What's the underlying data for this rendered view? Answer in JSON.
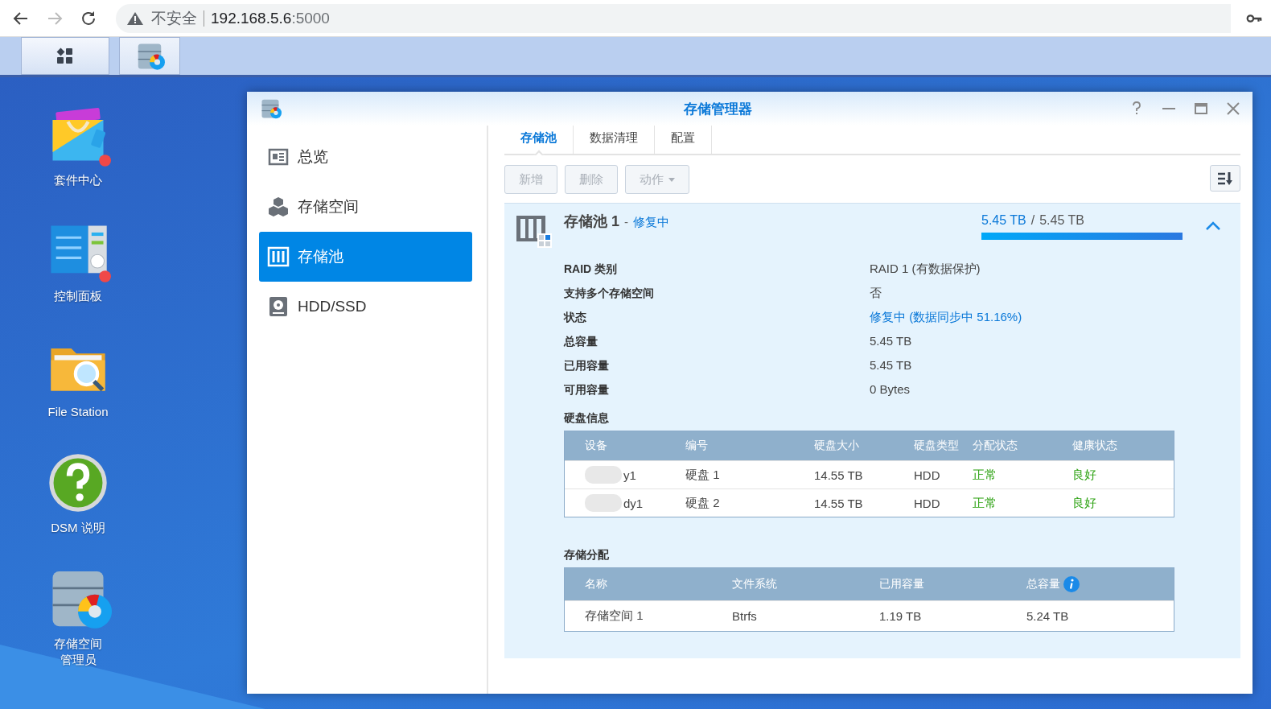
{
  "browser": {
    "security": "不安全",
    "url_host": "192.168.5.6",
    "url_port": ":5000"
  },
  "desktop_icons": [
    {
      "label": "套件中心",
      "kind": "package",
      "badge": true
    },
    {
      "label": "控制面板",
      "kind": "control",
      "badge": true
    },
    {
      "label": "File Station",
      "kind": "folder",
      "badge": false
    },
    {
      "label": "DSM 说明",
      "kind": "help",
      "badge": false
    },
    {
      "label": "存储空间管理员",
      "kind": "storage",
      "badge": false
    }
  ],
  "window": {
    "title": "存储管理器"
  },
  "sidebar": {
    "items": [
      {
        "label": "总览",
        "kind": "overview",
        "selected": false
      },
      {
        "label": "存储空间",
        "kind": "volume",
        "selected": false
      },
      {
        "label": "存储池",
        "kind": "pool",
        "selected": true
      },
      {
        "label": "HDD/SSD",
        "kind": "disk",
        "selected": false
      }
    ]
  },
  "tabs": [
    {
      "label": "存储池",
      "selected": true
    },
    {
      "label": "数据清理",
      "selected": false
    },
    {
      "label": "配置",
      "selected": false
    }
  ],
  "toolbar": {
    "buttons": [
      {
        "label": "新增",
        "disabled": true,
        "dropdown": false
      },
      {
        "label": "删除",
        "disabled": true,
        "dropdown": false
      },
      {
        "label": "动作",
        "disabled": true,
        "dropdown": true
      }
    ]
  },
  "pool": {
    "name": "存储池 1",
    "separator": "-",
    "status": "修复中",
    "used": "5.45 TB",
    "slash": "/",
    "total": "5.45 TB",
    "level": 1,
    "expanded": true,
    "properties": [
      {
        "label": "RAID 类别",
        "value": "RAID 1 (有数据保护)",
        "kind": "plain"
      },
      {
        "label": "支持多个存储空间",
        "value": "否",
        "kind": "plain"
      },
      {
        "label": "状态",
        "value": "修复中 (数据同步中 51.16%)",
        "kind": "status"
      },
      {
        "label": "总容量",
        "value": "5.45 TB",
        "kind": "plain"
      },
      {
        "label": "已用容量",
        "value": "5.45 TB",
        "kind": "plain"
      },
      {
        "label": "可用容量",
        "value": "0 Bytes",
        "kind": "plain"
      }
    ]
  },
  "disk_info": {
    "title": "硬盘信息",
    "columns": [
      {
        "label": "设备",
        "kind": "redacted"
      },
      {
        "label": "编号",
        "kind": "plain"
      },
      {
        "label": "硬盘大小",
        "kind": "plain"
      },
      {
        "label": "硬盘类型",
        "kind": "plain"
      },
      {
        "label": "分配状态",
        "kind": "good"
      },
      {
        "label": "健康状态",
        "kind": "good"
      }
    ],
    "rows": [
      {
        "cells": [
          "y1",
          "硬盘 1",
          "14.55 TB",
          "HDD",
          "正常",
          "良好"
        ]
      },
      {
        "cells": [
          "dy1",
          "硬盘 2",
          "14.55 TB",
          "HDD",
          "正常",
          "良好"
        ]
      }
    ]
  },
  "allocation": {
    "title": "存储分配",
    "columns": [
      {
        "label": "名称",
        "info": false
      },
      {
        "label": "文件系统",
        "info": false
      },
      {
        "label": "已用容量",
        "info": false
      },
      {
        "label": "总容量",
        "info": true
      }
    ],
    "rows": [
      {
        "cells": [
          "存储空间 1",
          "Btrfs",
          "1.19 TB",
          "5.24 TB"
        ]
      }
    ]
  }
}
